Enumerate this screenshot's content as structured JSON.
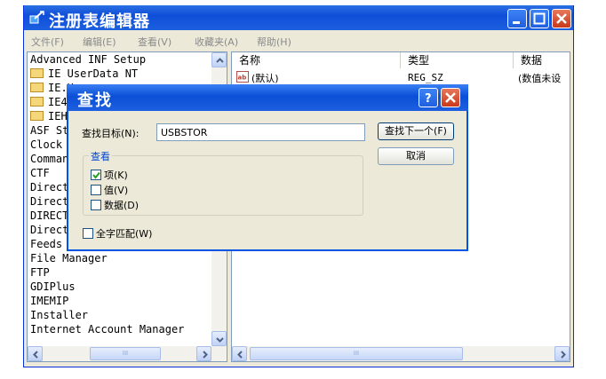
{
  "window": {
    "title": "注册表编辑器",
    "menu": [
      "文件(F)",
      "编辑(E)",
      "查看(V)",
      "收藏夹(A)",
      "帮助(H)"
    ]
  },
  "tree": {
    "items": [
      {
        "label": "Advanced INF Setup",
        "folder": false
      },
      {
        "label": "IE UserData NT",
        "folder": true
      },
      {
        "label": "IE.H",
        "folder": true
      },
      {
        "label": "IE40",
        "folder": true
      },
      {
        "label": "IEHo",
        "folder": true
      },
      {
        "label": "ASF St",
        "folder": false
      },
      {
        "label": "Clock",
        "folder": false
      },
      {
        "label": "Comman",
        "folder": false
      },
      {
        "label": "CTF",
        "folder": false
      },
      {
        "label": "Direct",
        "folder": false
      },
      {
        "label": "Direct",
        "folder": false
      },
      {
        "label": "DIRECT",
        "folder": false
      },
      {
        "label": "Direct",
        "folder": false
      },
      {
        "label": "Feeds",
        "folder": false
      },
      {
        "label": "File Manager",
        "folder": false
      },
      {
        "label": "FTP",
        "folder": false
      },
      {
        "label": "GDIPlus",
        "folder": false
      },
      {
        "label": "IMEMIP",
        "folder": false
      },
      {
        "label": "Installer",
        "folder": false
      },
      {
        "label": "Internet Account Manager",
        "folder": false
      }
    ],
    "scroll_thumb_label": "III"
  },
  "list": {
    "headers": [
      "名称",
      "类型",
      "数据"
    ],
    "rows": [
      {
        "name": "(默认)",
        "type": "REG_SZ",
        "data": "(数值未设"
      }
    ],
    "scroll_thumb_label": "III"
  },
  "dialog": {
    "title": "查找",
    "find_label": "查找目标(N):",
    "find_value": "USBSTOR",
    "find_next_label": "查找下一个(F)",
    "cancel_label": "取消",
    "group_label": "查看",
    "options": [
      {
        "label": "项(K)",
        "checked": true
      },
      {
        "label": "值(V)",
        "checked": false
      },
      {
        "label": "数据(D)",
        "checked": false
      }
    ],
    "match_whole_label": "全字匹配(W)",
    "match_whole_checked": false
  },
  "colors": {
    "titlebar_blue": "#0f4fd8",
    "close_red": "#c7391a",
    "window_face": "#ece9d8",
    "group_label_blue": "#0046d5"
  }
}
